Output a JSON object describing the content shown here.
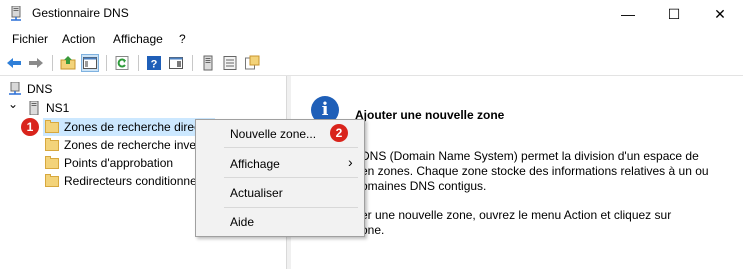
{
  "window": {
    "title": "Gestionnaire DNS",
    "controls": {
      "minimize": "—",
      "maximize": "☐",
      "close": "✕"
    }
  },
  "menu": {
    "items": [
      "Fichier",
      "Action",
      "Affichage",
      "?"
    ]
  },
  "toolbar": {
    "icons": [
      "back-arrow-icon",
      "forward-arrow-icon",
      "up-folder-icon",
      "console-tree-icon",
      "refresh-icon",
      "help-icon",
      "properties-icon",
      "server-icon",
      "list-icon",
      "zone-icon"
    ]
  },
  "tree": {
    "root": "DNS",
    "server": "NS1",
    "items": [
      "Zones de recherche direc",
      "Zones de recherche inve",
      "Points d'approbation",
      "Redirecteurs conditionne"
    ],
    "expand_glyph": "⌄"
  },
  "badges": {
    "step1": "1",
    "step2": "2"
  },
  "context_menu": {
    "new_zone": "Nouvelle zone...",
    "view": "Affichage",
    "view_arrow": "›",
    "refresh": "Actualiser",
    "help": "Aide"
  },
  "info_panel": {
    "icon_letter": "i",
    "title": "Ajouter une nouvelle zone",
    "para1": [
      "DNS (Domain Name System) permet la division d'un espace de",
      "en zones. Chaque zone stocke des informations relatives à un ou",
      "omaines DNS contigus."
    ],
    "para2": [
      "er une nouvelle zone, ouvrez le menu Action et cliquez sur",
      "one."
    ]
  },
  "colors": {
    "selection": "#cce8ff",
    "badge": "#d9241c",
    "info_icon": "#1f5fb8"
  }
}
